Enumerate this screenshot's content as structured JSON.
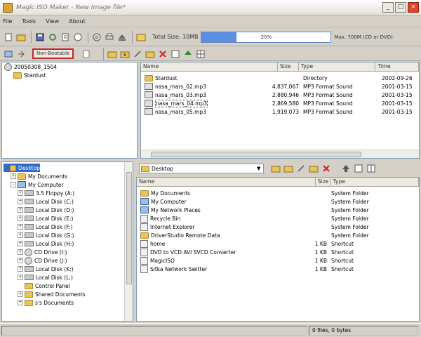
{
  "window": {
    "title": "Magic ISO Maker - New Image file*",
    "btn_min": "_",
    "btn_max": "□",
    "btn_close": "×"
  },
  "menu": [
    "File",
    "Tools",
    "View",
    "About"
  ],
  "toolbar": {
    "total_label": "Total Size: 10MB",
    "size_text": "20%",
    "size_fill_fraction": 0.27,
    "max_label": "Max. 700M (CD or DVD)"
  },
  "subbar": {
    "boot_label": "Non-Bootable"
  },
  "image_tree": {
    "root": "20050308_1504",
    "children": [
      "Stardust"
    ]
  },
  "image_list": {
    "columns": [
      "Name",
      "Size",
      "Type",
      "Time"
    ],
    "rows": [
      {
        "name": "Stardust",
        "size": "",
        "type": "Directory",
        "time": "2002-09-26",
        "icon": "folder"
      },
      {
        "name": "nasa_mars_02.mp3",
        "size": "4,837,067",
        "type": "MP3 Format Sound",
        "time": "2001-03-15",
        "icon": "mp3"
      },
      {
        "name": "nasa_mars_03.mp3",
        "size": "2,880,946",
        "type": "MP3 Format Sound",
        "time": "2001-03-15",
        "icon": "mp3"
      },
      {
        "name": "nasa_mars_04.mp3",
        "size": "2,869,580",
        "type": "MP3 Format Sound",
        "time": "2001-03-15",
        "icon": "mp3"
      },
      {
        "name": "nasa_mars_05.mp3",
        "size": "1,919,073",
        "type": "MP3 Format Sound",
        "time": "2001-03-15",
        "icon": "mp3"
      }
    ]
  },
  "local_tree": {
    "items": [
      {
        "label": "Desktop",
        "indent": 0,
        "icon": "folder",
        "exp": ""
      },
      {
        "label": "My Documents",
        "indent": 1,
        "icon": "folder",
        "exp": "+"
      },
      {
        "label": "My Computer",
        "indent": 1,
        "icon": "comp",
        "exp": "-"
      },
      {
        "label": "3.5 Floppy (A:)",
        "indent": 2,
        "icon": "disk",
        "exp": "+"
      },
      {
        "label": "Local Disk (C:)",
        "indent": 2,
        "icon": "disk",
        "exp": "+"
      },
      {
        "label": "Local Disk (D:)",
        "indent": 2,
        "icon": "disk",
        "exp": "+"
      },
      {
        "label": "Local Disk (E:)",
        "indent": 2,
        "icon": "disk",
        "exp": "+"
      },
      {
        "label": "Local Disk (F:)",
        "indent": 2,
        "icon": "disk",
        "exp": "+"
      },
      {
        "label": "Local Disk (G:)",
        "indent": 2,
        "icon": "disk",
        "exp": "+"
      },
      {
        "label": "Local Disk (H:)",
        "indent": 2,
        "icon": "disk",
        "exp": "+"
      },
      {
        "label": "CD Drive (I:)",
        "indent": 2,
        "icon": "cd",
        "exp": "+"
      },
      {
        "label": "CD Drive (J:)",
        "indent": 2,
        "icon": "cd",
        "exp": "+"
      },
      {
        "label": "Local Disk (K:)",
        "indent": 2,
        "icon": "disk",
        "exp": "+"
      },
      {
        "label": "Local Disk (L:)",
        "indent": 2,
        "icon": "disk",
        "exp": "+"
      },
      {
        "label": "Control Panel",
        "indent": 2,
        "icon": "folder",
        "exp": ""
      },
      {
        "label": "Shared Documents",
        "indent": 2,
        "icon": "folder",
        "exp": "+"
      },
      {
        "label": "s's Documents",
        "indent": 2,
        "icon": "folder",
        "exp": "+"
      }
    ]
  },
  "address": {
    "value": "Desktop"
  },
  "local_list": {
    "columns": [
      "Name",
      "Size",
      "Type"
    ],
    "rows": [
      {
        "name": "My Documents",
        "size": "",
        "type": "System Folder",
        "icon": "folder"
      },
      {
        "name": "My Computer",
        "size": "",
        "type": "System Folder",
        "icon": "comp"
      },
      {
        "name": "My Network Places",
        "size": "",
        "type": "System Folder",
        "icon": "comp"
      },
      {
        "name": "Recycle Bin",
        "size": "",
        "type": "System Folder",
        "icon": "shortcut"
      },
      {
        "name": "Internet Explorer",
        "size": "",
        "type": "System Folder",
        "icon": "shortcut"
      },
      {
        "name": "DriverStudio Remote Data",
        "size": "",
        "type": "System Folder",
        "icon": "folder"
      },
      {
        "name": "home",
        "size": "1 KB",
        "type": "Shortcut",
        "icon": "shortcut"
      },
      {
        "name": "DVD to VCD AVI SVCD Converter",
        "size": "1 KB",
        "type": "Shortcut",
        "icon": "shortcut"
      },
      {
        "name": "MagicISO",
        "size": "1 KB",
        "type": "Shortcut",
        "icon": "shortcut"
      },
      {
        "name": "Sitka Network Switter",
        "size": "1 KB",
        "type": "Shortcut",
        "icon": "shortcut"
      }
    ]
  },
  "status": {
    "files": "0 files, 0 bytes"
  }
}
